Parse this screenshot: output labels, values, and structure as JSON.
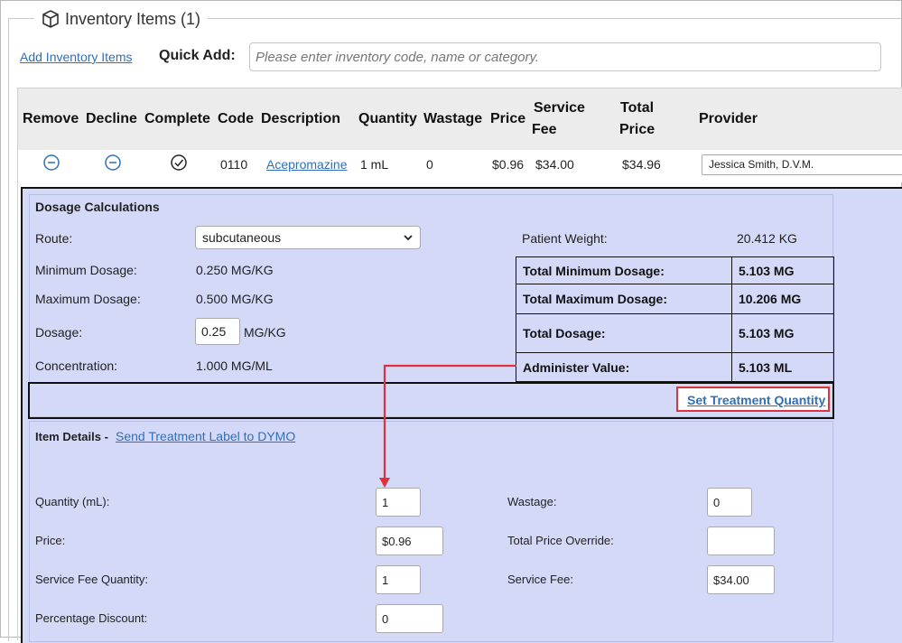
{
  "section": {
    "title": "Inventory Items (1)",
    "icon": "cube-icon"
  },
  "add_inventory_link": "Add Inventory Items",
  "quick_add": {
    "label": "Quick Add:",
    "placeholder": "Please enter inventory code, name or category."
  },
  "columns": {
    "remove": "Remove",
    "decline": "Decline",
    "complete": "Complete",
    "code": "Code",
    "description": "Description",
    "quantity": "Quantity",
    "wastage": "Wastage",
    "price": "Price",
    "service_fee_1": "Service",
    "service_fee_2": "Fee",
    "total_price_1": "Total",
    "total_price_2": "Price",
    "provider": "Provider"
  },
  "row": {
    "remove_icon": "minus-circle-icon",
    "decline_icon": "minus-circle-icon",
    "complete_icon": "check-circle-icon",
    "code": "0110",
    "description": "Acepromazine",
    "quantity": "1 mL",
    "wastage": "0",
    "price": "$0.96",
    "service_fee": "$34.00",
    "total_price": "$34.96",
    "provider": "Jessica Smith, D.V.M."
  },
  "dosage": {
    "heading": "Dosage Calculations",
    "route_label": "Route:",
    "route_value": "subcutaneous",
    "min_label": "Minimum Dosage:",
    "min_value": "0.250 MG/KG",
    "max_label": "Maximum Dosage:",
    "max_value": "0.500 MG/KG",
    "dosage_label": "Dosage:",
    "dosage_value": "0.25",
    "dosage_unit": "MG/KG",
    "conc_label": "Concentration:",
    "conc_value": "1.000 MG/ML",
    "weight_label": "Patient Weight:",
    "weight_value": "20.412 KG",
    "totals": [
      {
        "label": "Total Minimum Dosage:",
        "value": "5.103 MG"
      },
      {
        "label": "Total Maximum Dosage:",
        "value": "10.206 MG"
      },
      {
        "label": "Total Dosage:",
        "value": "5.103 MG"
      },
      {
        "label": "Administer Value:",
        "value": "5.103 ML"
      }
    ],
    "set_treatment_link": "Set Treatment Quantity"
  },
  "item_details": {
    "heading": "Item Details -",
    "dymo_link": "Send Treatment Label to DYMO",
    "qty_label": "Quantity (mL):",
    "qty_value": "1",
    "wastage_label": "Wastage:",
    "wastage_value": "0",
    "price_label": "Price:",
    "price_value": "$0.96",
    "override_label": "Total Price Override:",
    "override_value": "",
    "sfq_label": "Service Fee Quantity:",
    "sfq_value": "1",
    "sf_label": "Service Fee:",
    "sf_value": "$34.00",
    "discount_label": "Percentage Discount:",
    "discount_value": "0"
  },
  "colors": {
    "link": "#2f6fbb",
    "panel": "#d4d9f8",
    "annotation": "#e0323c"
  }
}
